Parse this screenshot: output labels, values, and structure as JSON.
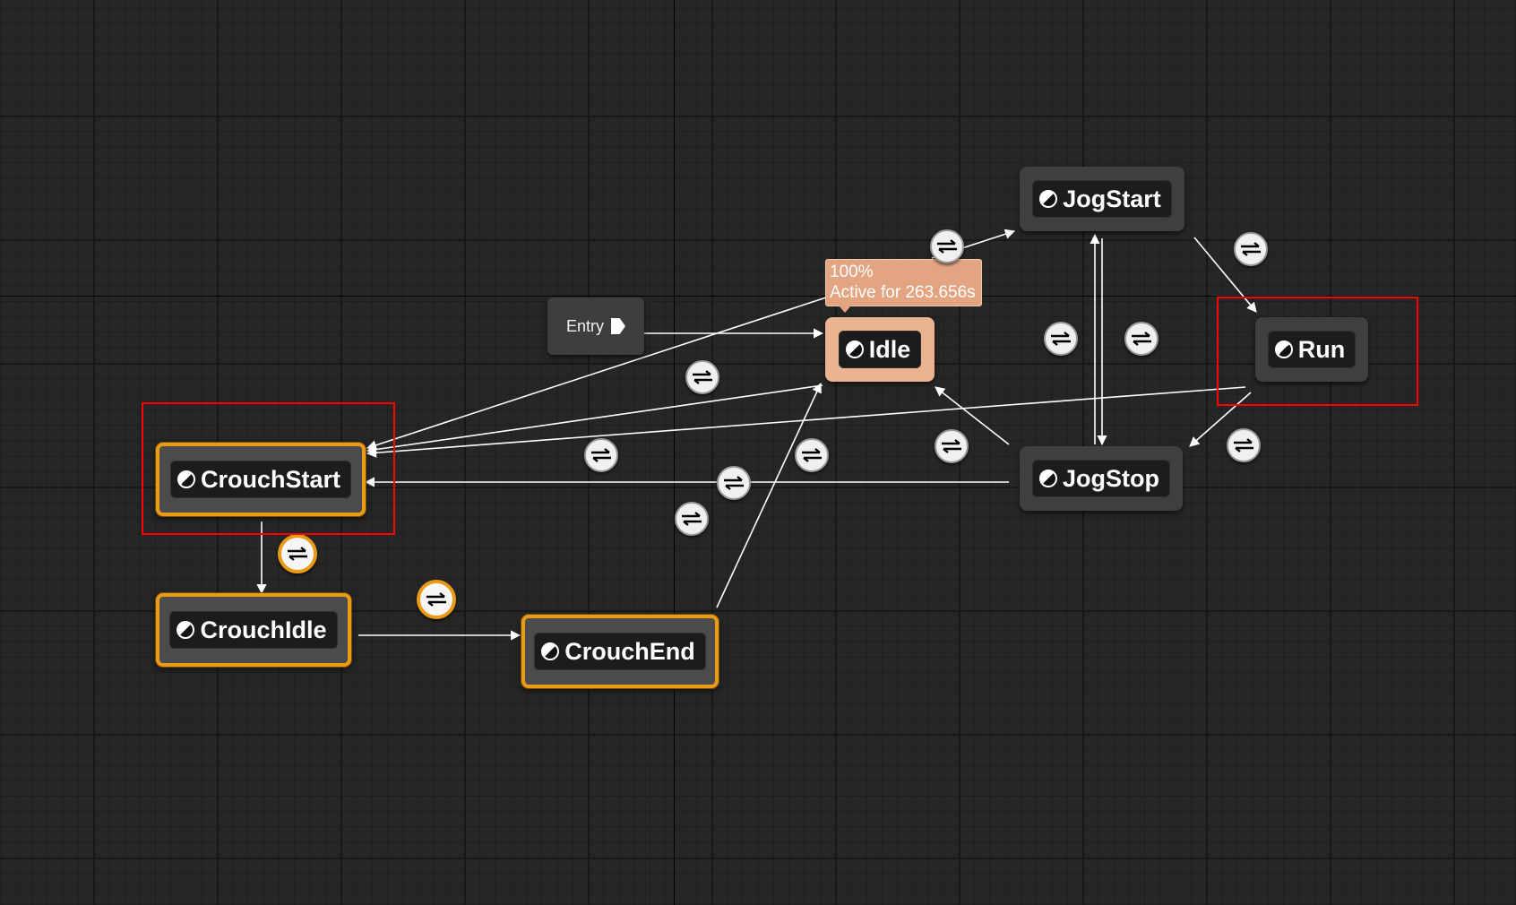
{
  "entry": {
    "label": "Entry"
  },
  "tooltip": {
    "percent": "100%",
    "active_text": "Active for 263.656s"
  },
  "states": {
    "jogstart": "JogStart",
    "idle": "Idle",
    "run": "Run",
    "crouchstart": "CrouchStart",
    "jogstop": "JogStop",
    "crouchidle": "CrouchIdle",
    "crouchend": "CrouchEnd"
  },
  "icons": {
    "state": "state-half-circle-icon",
    "transition": "transition-arrows-icon",
    "entry_pin": "exec-pin-icon"
  },
  "colors": {
    "active_border": "#e99b17",
    "idle_fill": "#ebb390",
    "highlight_box": "#ff0000",
    "wire": "#ffffff",
    "background": "#262626"
  }
}
